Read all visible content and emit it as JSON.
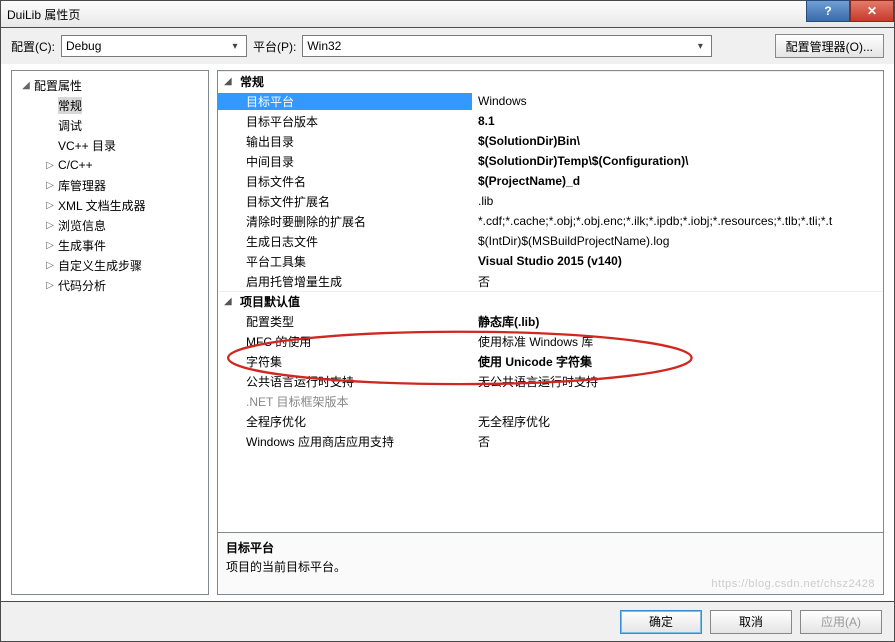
{
  "window": {
    "title": "DuiLib 属性页",
    "help_symbol": "?",
    "close_symbol": "✕"
  },
  "toolbar": {
    "config_label": "配置(C):",
    "config_value": "Debug",
    "platform_label": "平台(P):",
    "platform_value": "Win32",
    "manager_button": "配置管理器(O)..."
  },
  "tree": {
    "root": "配置属性",
    "items": [
      {
        "label": "常规",
        "highlight": true
      },
      {
        "label": "调试"
      },
      {
        "label": "VC++ 目录"
      },
      {
        "label": "C/C++",
        "expandable": true
      },
      {
        "label": "库管理器",
        "expandable": true
      },
      {
        "label": "XML 文档生成器",
        "expandable": true
      },
      {
        "label": "浏览信息",
        "expandable": true
      },
      {
        "label": "生成事件",
        "expandable": true
      },
      {
        "label": "自定义生成步骤",
        "expandable": true
      },
      {
        "label": "代码分析",
        "expandable": true
      }
    ]
  },
  "grid": {
    "sections": [
      {
        "title": "常规",
        "rows": [
          {
            "key": "目标平台",
            "val": "Windows",
            "selected": true
          },
          {
            "key": "目标平台版本",
            "val": "8.1",
            "bold": true
          },
          {
            "key": "输出目录",
            "val": "$(SolutionDir)Bin\\",
            "bold": true
          },
          {
            "key": "中间目录",
            "val": "$(SolutionDir)Temp\\$(Configuration)\\",
            "bold": true
          },
          {
            "key": "目标文件名",
            "val": "$(ProjectName)_d",
            "bold": true
          },
          {
            "key": "目标文件扩展名",
            "val": ".lib"
          },
          {
            "key": "清除时要删除的扩展名",
            "val": "*.cdf;*.cache;*.obj;*.obj.enc;*.ilk;*.ipdb;*.iobj;*.resources;*.tlb;*.tli;*.t"
          },
          {
            "key": "生成日志文件",
            "val": "$(IntDir)$(MSBuildProjectName).log"
          },
          {
            "key": "平台工具集",
            "val": "Visual Studio 2015 (v140)",
            "bold": true
          },
          {
            "key": "启用托管增量生成",
            "val": "否"
          }
        ]
      },
      {
        "title": "项目默认值",
        "rows": [
          {
            "key": "配置类型",
            "val": "静态库(.lib)",
            "bold": true
          },
          {
            "key": "MFC 的使用",
            "val": "使用标准 Windows 库"
          },
          {
            "key": "字符集",
            "val": "使用 Unicode 字符集",
            "bold": true
          },
          {
            "key": "公共语言运行时支持",
            "val": "无公共语言运行时支持"
          },
          {
            "key": ".NET 目标框架版本",
            "val": "",
            "dim": true
          },
          {
            "key": "全程序优化",
            "val": "无全程序优化"
          },
          {
            "key": "Windows 应用商店应用支持",
            "val": "否"
          }
        ]
      }
    ]
  },
  "desc": {
    "title": "目标平台",
    "text": "项目的当前目标平台。"
  },
  "buttons": {
    "ok": "确定",
    "cancel": "取消",
    "apply": "应用(A)"
  },
  "watermark": "https://blog.csdn.net/chsz2428"
}
